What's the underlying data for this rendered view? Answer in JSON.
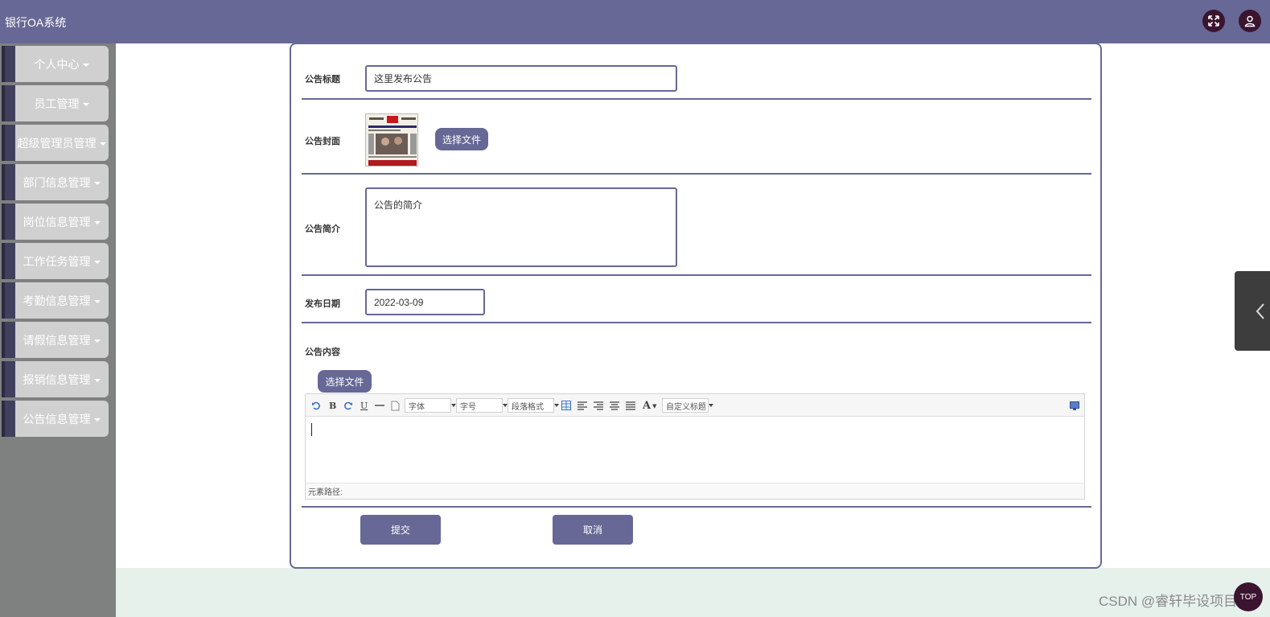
{
  "header": {
    "app_title": "银行OA系统",
    "fullscreen_icon": "fullscreen-icon",
    "user_icon": "user-icon"
  },
  "sidebar": {
    "items": [
      {
        "label": "个人中心"
      },
      {
        "label": "员工管理"
      },
      {
        "label": "超级管理员管理"
      },
      {
        "label": "部门信息管理"
      },
      {
        "label": "岗位信息管理"
      },
      {
        "label": "工作任务管理"
      },
      {
        "label": "考勤信息管理"
      },
      {
        "label": "请假信息管理"
      },
      {
        "label": "报销信息管理"
      },
      {
        "label": "公告信息管理"
      }
    ]
  },
  "form": {
    "title_label": "公告标题",
    "title_value": "这里发布公告",
    "cover_label": "公告封面",
    "cover_button": "选择文件",
    "intro_label": "公告简介",
    "intro_value": "公告的简介",
    "date_label": "发布日期",
    "date_value": "2022-03-09",
    "content_label": "公告内容",
    "content_file_button": "选择文件",
    "submit_label": "提交",
    "cancel_label": "取消"
  },
  "editor": {
    "font_family": "字体",
    "font_size": "字号",
    "paragraph": "段落格式",
    "custom_title": "自定义标题",
    "text_color_glyph": "A",
    "bold_glyph": "B",
    "underline_glyph": "U",
    "element_path": "元素路径:"
  },
  "watermark": "CSDN @睿轩毕设项目",
  "top_button": "TOP",
  "colors": {
    "primary": "#676896",
    "sidebar_bg": "#7f8180",
    "menu_bg": "#cfd0cf",
    "accent_dark": "#3b1530",
    "bottom_band": "#e6f1ec"
  }
}
